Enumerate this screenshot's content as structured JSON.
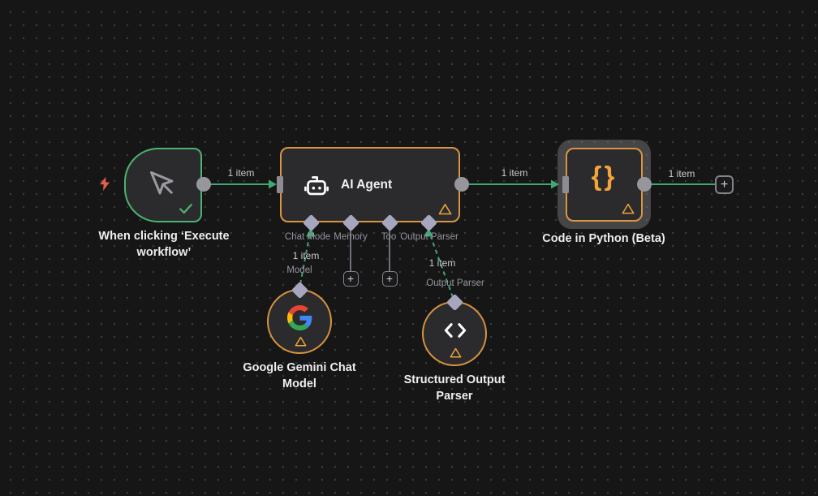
{
  "canvas": {
    "background": "#161616",
    "grid_dot_color": "#3c3c3c"
  },
  "colors": {
    "connection_green": "#3fa873",
    "trigger_border_green": "#4bb372",
    "node_border_orange": "#d9953f",
    "warning_orange": "#f2a33c",
    "google_red": "#EA4335",
    "google_blue": "#4285F4",
    "google_yellow": "#FBBC05",
    "google_green": "#34A853"
  },
  "connections": {
    "item_count": "1 item",
    "model_label": "Model",
    "output_parser_label": "Output Parser"
  },
  "agent_connectors": {
    "chat_model": "Chat Mode",
    "memory": "Memory",
    "tool": "Too",
    "output_parser": "Output Parser"
  },
  "nodes": {
    "trigger": {
      "title_line1": "When clicking ‘Execute",
      "title_line2": "workflow’"
    },
    "agent": {
      "title": "AI Agent"
    },
    "python": {
      "title": "Code in Python (Beta)",
      "icon_glyph": "{}"
    },
    "gemini": {
      "title_line1": "Google Gemini Chat",
      "title_line2": "Model"
    },
    "output_parser": {
      "title_line1": "Structured Output",
      "title_line2": "Parser"
    }
  },
  "glyphs": {
    "plus": "+"
  }
}
